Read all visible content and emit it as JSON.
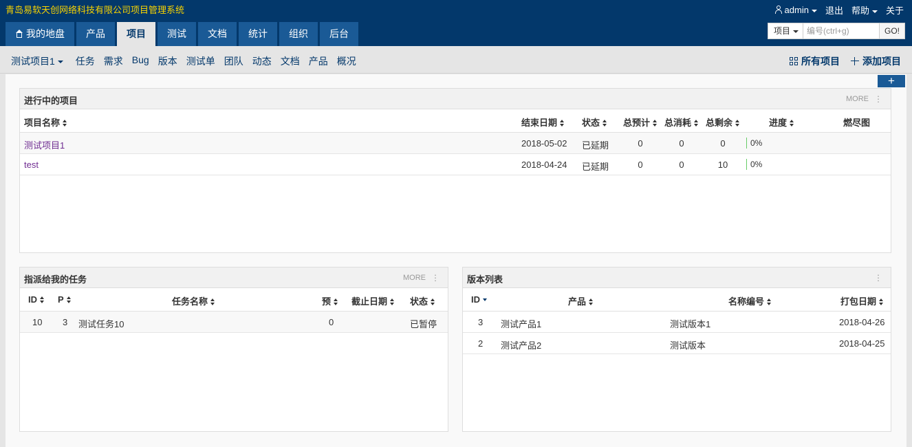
{
  "header": {
    "company": "青岛易软天创网络科技有限公司项目管理系统",
    "user": "admin",
    "logout": "退出",
    "help": "帮助",
    "about": "关于"
  },
  "mainnav": [
    "我的地盘",
    "产品",
    "项目",
    "测试",
    "文档",
    "统计",
    "组织",
    "后台"
  ],
  "active_tab": "项目",
  "search": {
    "type": "项目",
    "placeholder": "编号(ctrl+g)",
    "go": "GO!"
  },
  "subnav": {
    "current_project": "测试项目1",
    "items": [
      "任务",
      "需求",
      "Bug",
      "版本",
      "测试单",
      "团队",
      "动态",
      "文档",
      "产品",
      "概况"
    ],
    "all_projects": "所有项目",
    "add_project": "添加项目"
  },
  "add_block": "+",
  "ongoing": {
    "title": "进行中的项目",
    "more": "MORE",
    "columns": [
      "项目名称",
      "结束日期",
      "状态",
      "总预计",
      "总消耗",
      "总剩余",
      "进度",
      "燃尽图"
    ],
    "rows": [
      {
        "name": "测试项目1",
        "end": "2018-05-02",
        "status": "已延期",
        "est": "0",
        "consumed": "0",
        "left": "0",
        "progress": "0%"
      },
      {
        "name": "test",
        "end": "2018-04-24",
        "status": "已延期",
        "est": "0",
        "consumed": "0",
        "left": "10",
        "progress": "0%"
      }
    ]
  },
  "tasks": {
    "title": "指派给我的任务",
    "more": "MORE",
    "columns": [
      "ID",
      "P",
      "任务名称",
      "预",
      "截止日期",
      "状态"
    ],
    "rows": [
      {
        "id": "10",
        "pri": "3",
        "name": "测试任务10",
        "est": "0",
        "deadline": "",
        "status": "已暂停"
      }
    ]
  },
  "builds": {
    "title": "版本列表",
    "columns": [
      "ID",
      "产品",
      "名称编号",
      "打包日期"
    ],
    "rows": [
      {
        "id": "3",
        "product": "测试产品1",
        "name": "测试版本1",
        "date": "2018-04-26"
      },
      {
        "id": "2",
        "product": "测试产品2",
        "name": "测试版本",
        "date": "2018-04-25"
      }
    ]
  }
}
